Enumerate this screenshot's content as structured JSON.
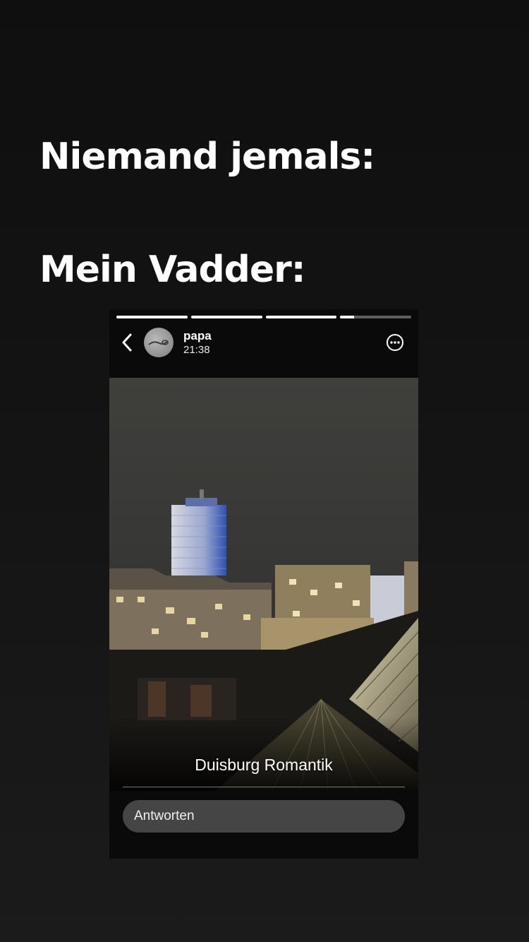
{
  "meme": {
    "line1": "Niemand jemals:",
    "line2": "Mein Vadder:"
  },
  "story": {
    "progress_segments": [
      1,
      1,
      1,
      0.2
    ],
    "username": "papa",
    "time": "21:38",
    "caption": "Duisburg Romantik",
    "reply_placeholder": "Antworten",
    "icons": {
      "back": "chevron-left-icon",
      "more": "more-options-icon"
    }
  }
}
